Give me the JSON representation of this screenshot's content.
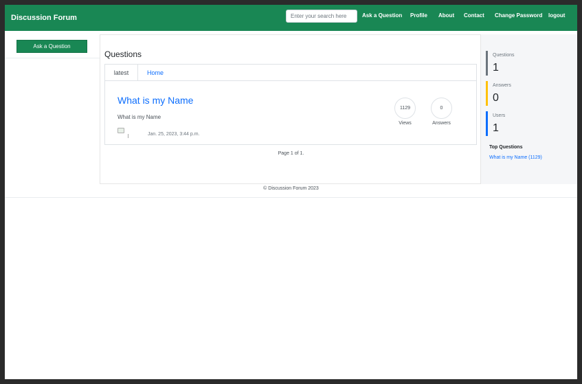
{
  "navbar": {
    "brand": "Discussion Forum",
    "search_placeholder": "Enter your search here",
    "links": [
      "Ask a Question",
      "Profile",
      "About",
      "Contact",
      "Change Password",
      "logout"
    ]
  },
  "left": {
    "ask_button": "Ask a Question"
  },
  "main": {
    "title": "Questions",
    "tabs": [
      "latest",
      "Home"
    ],
    "question": {
      "title": "What is my Name",
      "body": "What is my Name",
      "date": "Jan. 25, 2023, 3:44 p.m.",
      "views": "1129",
      "views_label": "Views",
      "answers": "0",
      "answers_label": "Answers"
    },
    "pagination": "Page 1 of 1."
  },
  "sidebar": {
    "stats": [
      {
        "label": "Questions",
        "value": "1",
        "color": "#6c757d"
      },
      {
        "label": "Answers",
        "value": "0",
        "color": "#ffc107"
      },
      {
        "label": "Users",
        "value": "1",
        "color": "#0d6efd"
      }
    ],
    "top_heading": "Top Questions",
    "top_items": [
      "What is my Name (1129)"
    ]
  },
  "footer": "© Discussion Forum 2023",
  "colors": {
    "primary": "#198754",
    "link": "#0d6efd"
  },
  "icons": [
    "broken-image-icon"
  ]
}
